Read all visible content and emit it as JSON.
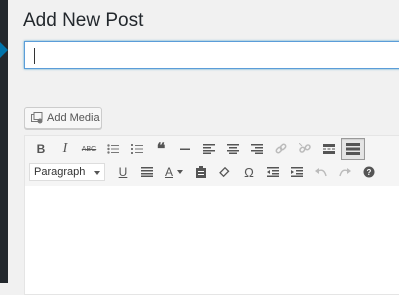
{
  "page": {
    "title": "Add New Post"
  },
  "title_field": {
    "value": "",
    "placeholder": ""
  },
  "media": {
    "add_media_label": "Add Media"
  },
  "editor": {
    "format_select": {
      "selected": "Paragraph"
    },
    "toolbar_row1": [
      {
        "name": "bold-button",
        "glyph": "B"
      },
      {
        "name": "italic-button",
        "glyph": "I"
      },
      {
        "name": "strikethrough-button",
        "glyph": "ABC"
      },
      {
        "name": "bulleted-list-button",
        "glyph": "•≡"
      },
      {
        "name": "numbered-list-button",
        "glyph": "1≡"
      },
      {
        "name": "blockquote-button",
        "glyph": "❝"
      },
      {
        "name": "horizontal-line-button",
        "glyph": "—"
      },
      {
        "name": "align-left-button",
        "glyph": "≡"
      },
      {
        "name": "align-center-button",
        "glyph": "≡"
      },
      {
        "name": "align-right-button",
        "glyph": "≡"
      },
      {
        "name": "insert-link-button",
        "glyph": "🔗"
      },
      {
        "name": "remove-link-button",
        "glyph": "⛓"
      },
      {
        "name": "read-more-button",
        "glyph": "▭"
      },
      {
        "name": "toolbar-toggle-button",
        "glyph": "▦"
      }
    ],
    "toolbar_row2": [
      {
        "name": "underline-button",
        "glyph": "U"
      },
      {
        "name": "justify-button",
        "glyph": "≡"
      },
      {
        "name": "text-color-button",
        "glyph": "A"
      },
      {
        "name": "paste-as-text-button",
        "glyph": "📋"
      },
      {
        "name": "clear-formatting-button",
        "glyph": "⌫"
      },
      {
        "name": "special-character-button",
        "glyph": "Ω"
      },
      {
        "name": "outdent-button",
        "glyph": "⇤"
      },
      {
        "name": "indent-button",
        "glyph": "⇥"
      },
      {
        "name": "undo-button",
        "glyph": "↶"
      },
      {
        "name": "redo-button",
        "glyph": "↷"
      },
      {
        "name": "keyboard-shortcuts-button",
        "glyph": "?"
      }
    ]
  },
  "colors": {
    "accent": "#0073aa",
    "focus": "#5b9dd9",
    "sidebar": "#23282d"
  }
}
